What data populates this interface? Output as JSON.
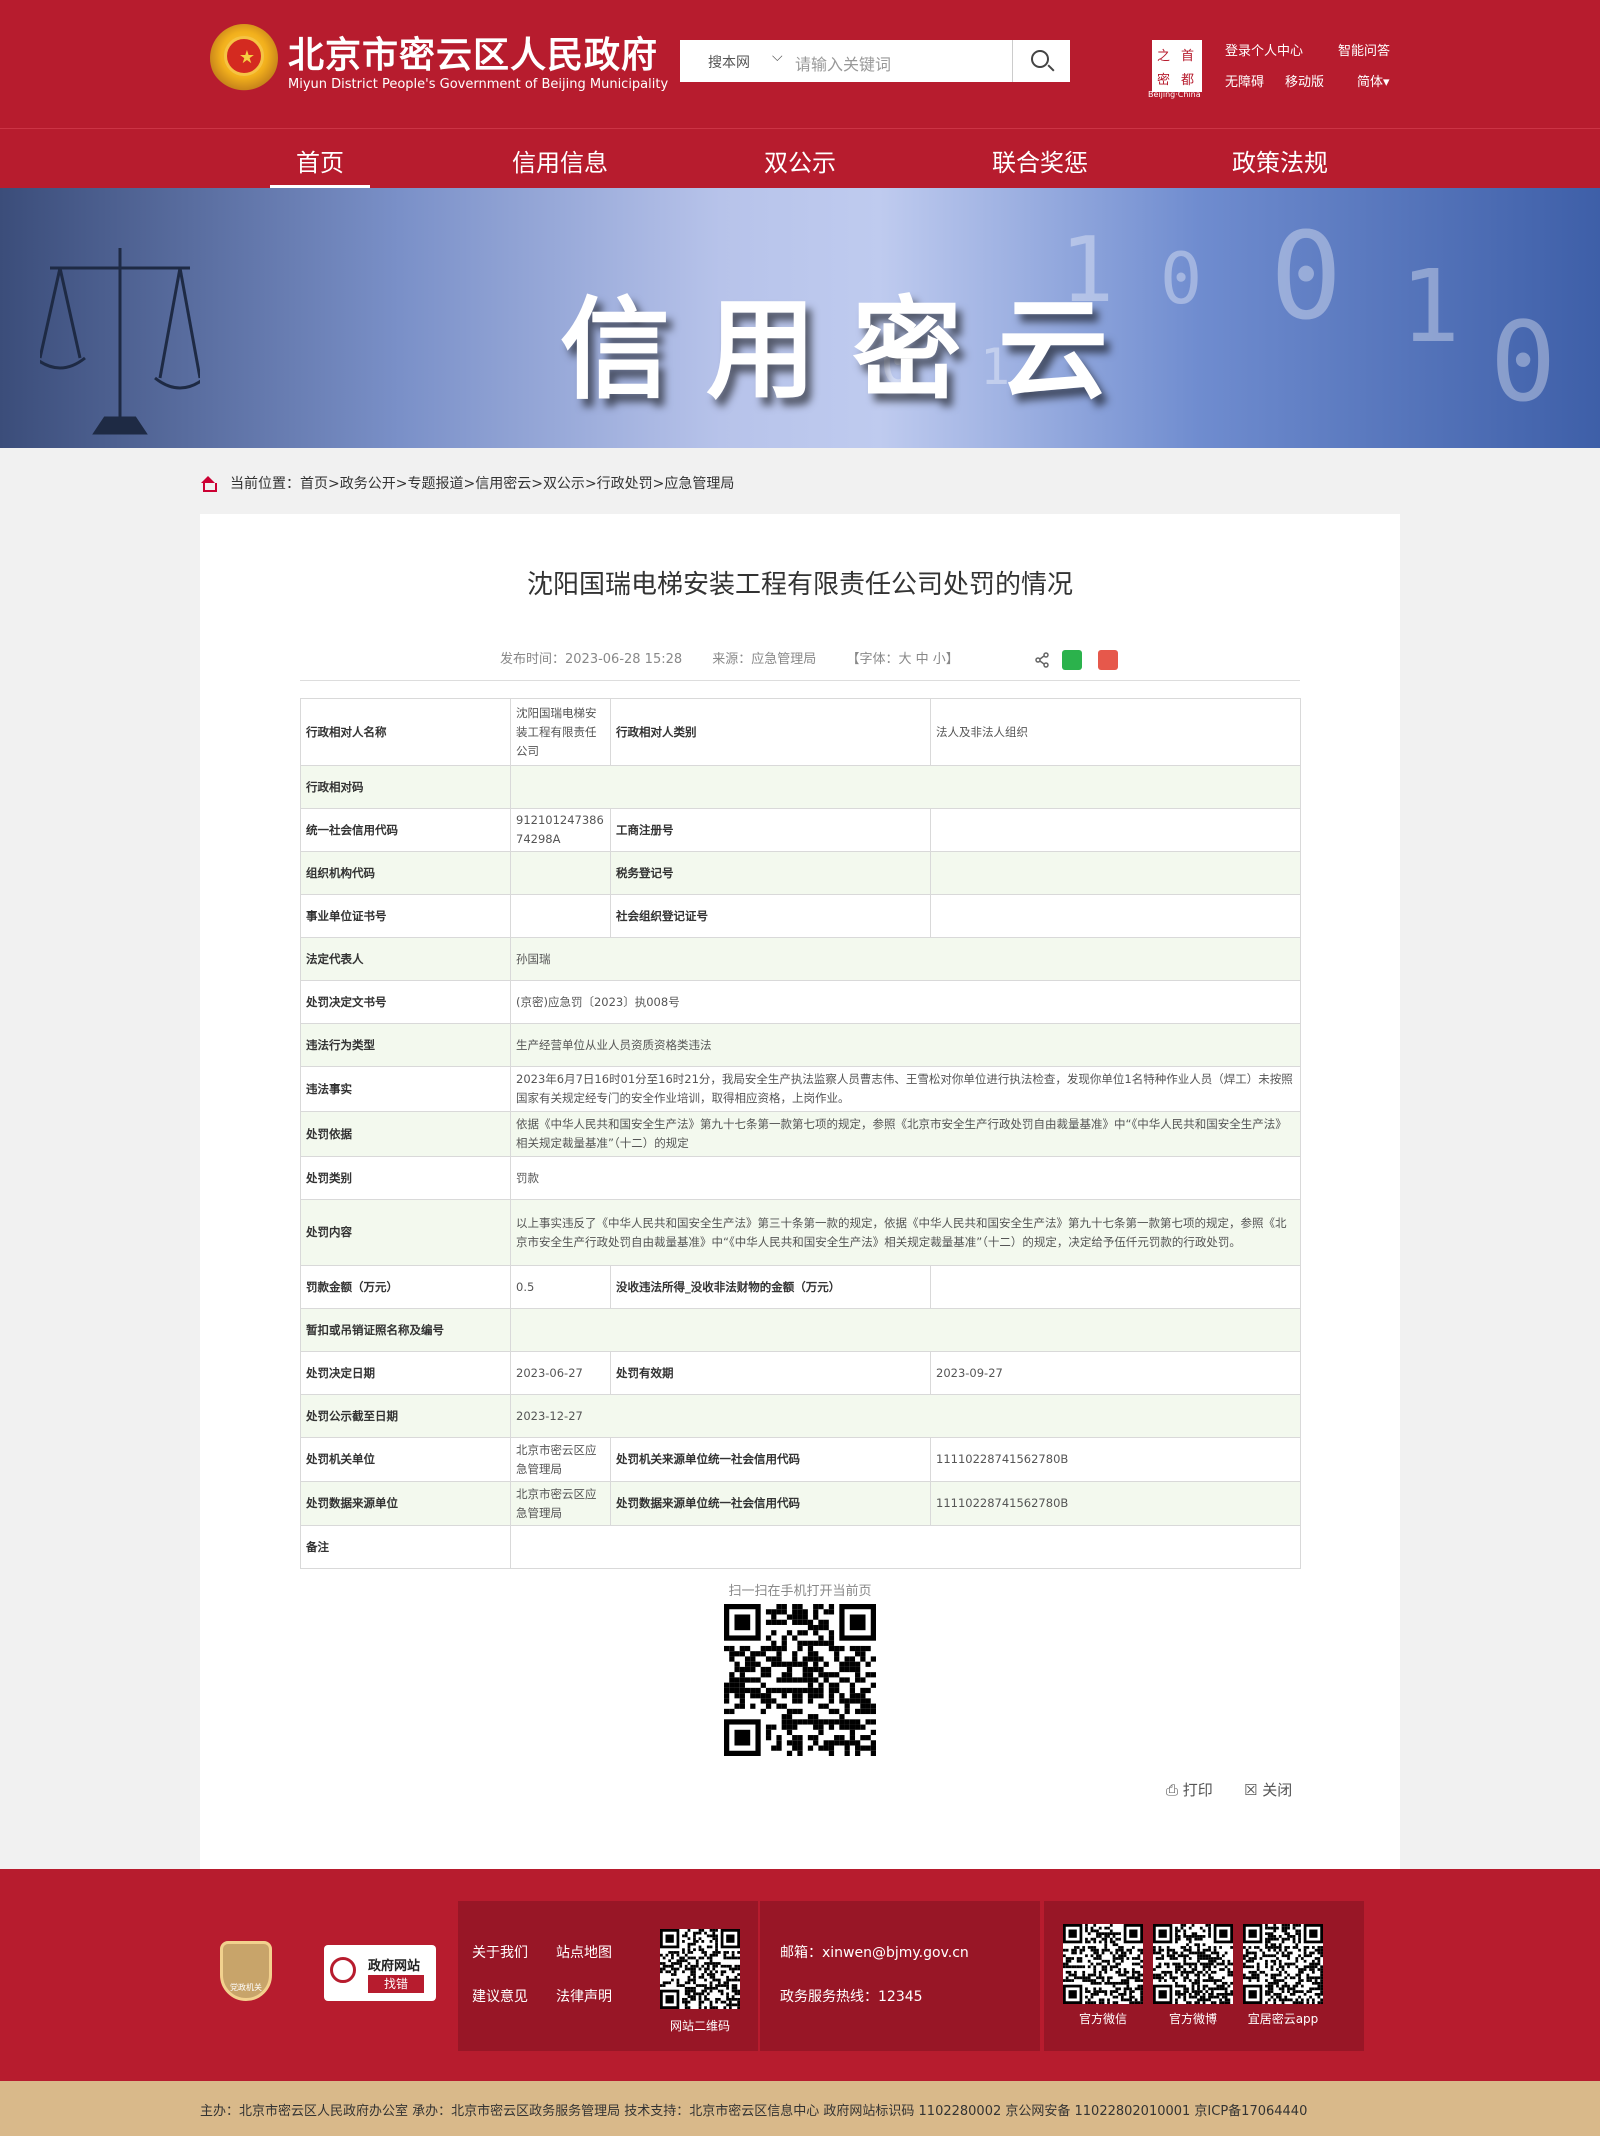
{
  "header": {
    "title": "北京市密云区人民政府",
    "subtitle": "Miyun District People's Government of Beijing Municipality",
    "search": {
      "scope": "搜本网",
      "placeholder": "请输入关键词"
    },
    "capital_logo": {
      "chars": [
        "之",
        "首",
        "密",
        "都"
      ],
      "caption": "Beijing·China"
    },
    "links": [
      "登录个人中心",
      "智能问答",
      "无障碍",
      "移动版",
      "简体"
    ]
  },
  "nav": [
    "首页",
    "信用信息",
    "双公示",
    "联合奖惩",
    "政策法规"
  ],
  "banner": {
    "title": "信用密云"
  },
  "breadcrumb": {
    "prefix": "当前位置：",
    "items": [
      "首页",
      "政务公开",
      "专题报道",
      "信用密云",
      "双公示",
      "行政处罚",
      "应急管理局"
    ]
  },
  "article": {
    "title": "沈阳国瑞电梯安装工程有限责任公司处罚的情况",
    "publish_time": "发布时间：2023-06-28 15:28",
    "source": "来源：应急管理局",
    "font_size": "【字体：大  中  小】"
  },
  "table": {
    "name_label": "行政相对人名称",
    "name_value": "沈阳国瑞电梯安装工程有限责任公司",
    "category_label": "行政相对人类别",
    "category_value": "法人及非法人组织",
    "code_label": "行政相对码",
    "credit_label": "统一社会信用代码",
    "credit_value": "91210124738674298A",
    "biz_reg_label": "工商注册号",
    "biz_reg_value": "",
    "org_label": "组织机构代码",
    "org_value": "",
    "tax_label": "税务登记号",
    "tax_value": "",
    "inst_label": "事业单位证书号",
    "inst_value": "",
    "social_label": "社会组织登记证号",
    "social_value": "",
    "legal_rep_label": "法定代表人",
    "legal_rep_value": "孙国瑞",
    "doc_no_label": "处罚决定文书号",
    "doc_no_value": "(京密)应急罚〔2023〕执008号",
    "violation_type_label": "违法行为类型",
    "violation_type_value": "生产经营单位从业人员资质资格类违法",
    "facts_label": "违法事实",
    "facts_value": "2023年6月7日16时01分至16时21分，我局安全生产执法监察人员曹志伟、王雪松对你单位进行执法检查，发现你单位1名特种作业人员（焊工）未按照国家有关规定经专门的安全作业培训，取得相应资格，上岗作业。",
    "basis_label": "处罚依据",
    "basis_value": "依据《中华人民共和国安全生产法》第九十七条第一款第七项的规定，参照《北京市安全生产行政处罚自由裁量基准》中“《中华人民共和国安全生产法》相关规定裁量基准”（十二）的规定",
    "penalty_type_label": "处罚类别",
    "penalty_type_value": "罚款",
    "content_label": "处罚内容",
    "content_value": "以上事实违反了《中华人民共和国安全生产法》第三十条第一款的规定，依据《中华人民共和国安全生产法》第九十七条第一款第七项的规定，参照《北京市安全生产行政处罚自由裁量基准》中“《中华人民共和国安全生产法》相关规定裁量基准”（十二）的规定，决定给予伍仟元罚款的行政处罚。",
    "fine_label": "罚款金额（万元）",
    "fine_value": "0.5",
    "confiscate_label": "没收违法所得_没收非法财物的金额（万元）",
    "confiscate_value": "",
    "license_label": "暂扣或吊销证照名称及编号",
    "license_value": "",
    "decision_date_label": "处罚决定日期",
    "decision_date_value": "2023-06-27",
    "valid_label": "处罚有效期",
    "valid_value": "2023-09-27",
    "publish_end_label": "处罚公示截至日期",
    "publish_end_value": "2023-12-27",
    "authority_label": "处罚机关单位",
    "authority_value": "北京市密云区应急管理局",
    "authority_code_label": "处罚机关来源单位统一社会信用代码",
    "authority_code_value": "11110228741562780B",
    "data_src_label": "处罚数据来源单位",
    "data_src_value": "北京市密云区应急管理局",
    "data_src_code_label": "处罚数据来源单位统一社会信用代码",
    "data_src_code_value": "11110228741562780B",
    "remark_label": "备注",
    "remark_value": ""
  },
  "qr_label": "扫一扫在手机打开当前页",
  "actions": {
    "print": "打印",
    "close": "关闭"
  },
  "footer": {
    "badge_label": "党政机关",
    "gov_site_label": "政府网站",
    "gov_site_sub": "找错",
    "links": [
      "关于我们",
      "站点地图",
      "建议意见",
      "法律声明"
    ],
    "site_qr_label": "网站二维码",
    "email": "邮箱：xinwen@bjmy.gov.cn",
    "hotline": "政务服务热线：12345",
    "qr_labels": [
      "官方微信",
      "官方微博",
      "宜居密云app"
    ]
  },
  "bottom_bar": "主办：北京市密云区人民政府办公室   承办：北京市密云区政务服务管理局   技术支持：北京市密云区信息中心   政府网站标识码  1102280002  京公网安备  11022802010001  京ICP备17064440",
  "colors": {
    "brand_red": "#b71c2e",
    "footer_dark": "#981626",
    "bottom_bar": "#d9b98a",
    "row_tint": "#f3f9ee"
  }
}
